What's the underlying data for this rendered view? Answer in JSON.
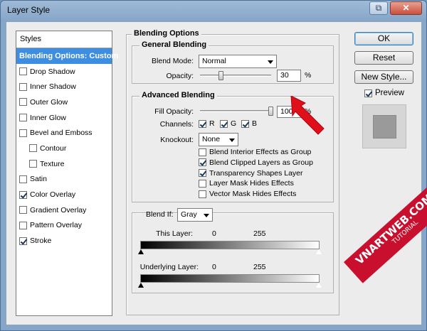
{
  "window": {
    "title": "Layer Style",
    "restore_glyph": "⧉",
    "close_glyph": "✕"
  },
  "styles": {
    "header": "Styles",
    "items": [
      {
        "label": "Blending Options: Custom",
        "active": true,
        "checkbox": false,
        "checked": false,
        "indent": false
      },
      {
        "label": "Drop Shadow",
        "active": false,
        "checkbox": true,
        "checked": false,
        "indent": false
      },
      {
        "label": "Inner Shadow",
        "active": false,
        "checkbox": true,
        "checked": false,
        "indent": false
      },
      {
        "label": "Outer Glow",
        "active": false,
        "checkbox": true,
        "checked": false,
        "indent": false
      },
      {
        "label": "Inner Glow",
        "active": false,
        "checkbox": true,
        "checked": false,
        "indent": false
      },
      {
        "label": "Bevel and Emboss",
        "active": false,
        "checkbox": true,
        "checked": false,
        "indent": false
      },
      {
        "label": "Contour",
        "active": false,
        "checkbox": true,
        "checked": false,
        "indent": true
      },
      {
        "label": "Texture",
        "active": false,
        "checkbox": true,
        "checked": false,
        "indent": true
      },
      {
        "label": "Satin",
        "active": false,
        "checkbox": true,
        "checked": false,
        "indent": false
      },
      {
        "label": "Color Overlay",
        "active": false,
        "checkbox": true,
        "checked": true,
        "indent": false
      },
      {
        "label": "Gradient Overlay",
        "active": false,
        "checkbox": true,
        "checked": false,
        "indent": false
      },
      {
        "label": "Pattern Overlay",
        "active": false,
        "checkbox": true,
        "checked": false,
        "indent": false
      },
      {
        "label": "Stroke",
        "active": false,
        "checkbox": true,
        "checked": true,
        "indent": false
      }
    ]
  },
  "blending_options": {
    "title": "Blending Options",
    "general": {
      "title": "General Blending",
      "blend_mode_label": "Blend Mode:",
      "blend_mode_value": "Normal",
      "opacity_label": "Opacity:",
      "opacity_value": "30",
      "opacity_level": 30,
      "percent": "%"
    },
    "advanced": {
      "title": "Advanced Blending",
      "fill_opacity_label": "Fill Opacity:",
      "fill_opacity_value": "100",
      "fill_opacity_level": 100,
      "percent": "%",
      "channels_label": "Channels:",
      "channels": [
        {
          "label": "R",
          "checked": true
        },
        {
          "label": "G",
          "checked": true
        },
        {
          "label": "B",
          "checked": true
        }
      ],
      "knockout_label": "Knockout:",
      "knockout_value": "None",
      "options": [
        {
          "label": "Blend Interior Effects as Group",
          "checked": false
        },
        {
          "label": "Blend Clipped Layers as Group",
          "checked": true
        },
        {
          "label": "Transparency Shapes Layer",
          "checked": true
        },
        {
          "label": "Layer Mask Hides Effects",
          "checked": false
        },
        {
          "label": "Vector Mask Hides Effects",
          "checked": false
        }
      ]
    },
    "blend_if": {
      "label": "Blend If:",
      "value": "Gray",
      "this_layer_label": "This Layer:",
      "this_layer_min": "0",
      "this_layer_max": "255",
      "underlying_label": "Underlying Layer:",
      "underlying_min": "0",
      "underlying_max": "255"
    }
  },
  "buttons": {
    "ok": "OK",
    "reset": "Reset",
    "new_style": "New Style...",
    "preview_label": "Preview",
    "preview_checked": true
  },
  "watermark": {
    "text": "VNARTWEB.COM",
    "sub": "TUTORIAL"
  },
  "colors": {
    "accent": "#3d8ee0",
    "annotation": "#e0101a",
    "watermark": "#c8102e"
  }
}
